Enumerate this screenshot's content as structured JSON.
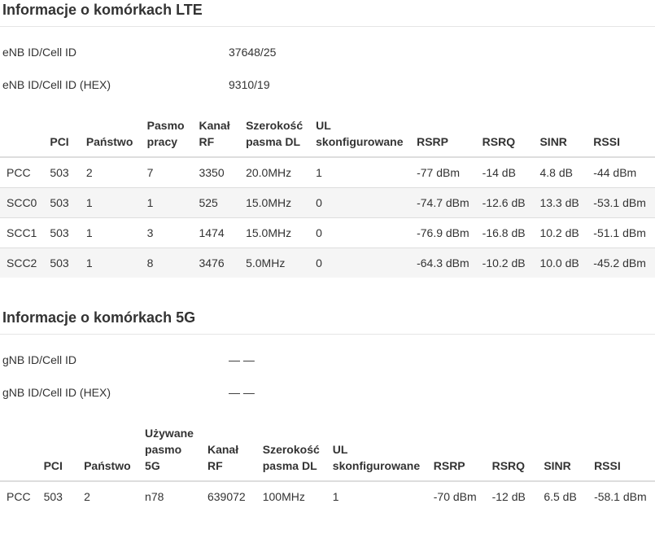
{
  "lte": {
    "title": "Informacje o komórkach LTE",
    "info": [
      {
        "label": "eNB ID/Cell ID",
        "value": "37648/25"
      },
      {
        "label": "eNB ID/Cell ID (HEX)",
        "value": "9310/19"
      }
    ],
    "headers": [
      "",
      "PCI",
      "Państwo",
      "Pasmo\npracy",
      "Kanał\nRF",
      "Szerokość\npasma DL",
      "UL\nskonfigurowane",
      "RSRP",
      "RSRQ",
      "SINR",
      "RSSI"
    ],
    "rows": [
      [
        "PCC",
        "503",
        "2",
        "7",
        "3350",
        "20.0MHz",
        "1",
        "-77 dBm",
        "-14 dB",
        "4.8 dB",
        "-44 dBm"
      ],
      [
        "SCC0",
        "503",
        "1",
        "1",
        "525",
        "15.0MHz",
        "0",
        "-74.7 dBm",
        "-12.6 dB",
        "13.3 dB",
        "-53.1 dBm"
      ],
      [
        "SCC1",
        "503",
        "1",
        "3",
        "1474",
        "15.0MHz",
        "0",
        "-76.9 dBm",
        "-16.8 dB",
        "10.2 dB",
        "-51.1 dBm"
      ],
      [
        "SCC2",
        "503",
        "1",
        "8",
        "3476",
        "5.0MHz",
        "0",
        "-64.3 dBm",
        "-10.2 dB",
        "10.0 dB",
        "-45.2 dBm"
      ]
    ]
  },
  "nr": {
    "title": "Informacje o komórkach 5G",
    "info": [
      {
        "label": "gNB ID/Cell ID",
        "value": "— —"
      },
      {
        "label": "gNB ID/Cell ID (HEX)",
        "value": "— —"
      }
    ],
    "headers": [
      "",
      "PCI",
      "Państwo",
      "Używane\npasmo\n5G",
      "Kanał\nRF",
      "Szerokość\npasma DL",
      "UL\nskonfigurowane",
      "RSRP",
      "RSRQ",
      "SINR",
      "RSSI"
    ],
    "rows": [
      [
        "PCC",
        "503",
        "2",
        "n78",
        "639072",
        "100MHz",
        "1",
        "-70 dBm",
        "-12 dB",
        "6.5 dB",
        "-58.1 dBm"
      ]
    ]
  }
}
